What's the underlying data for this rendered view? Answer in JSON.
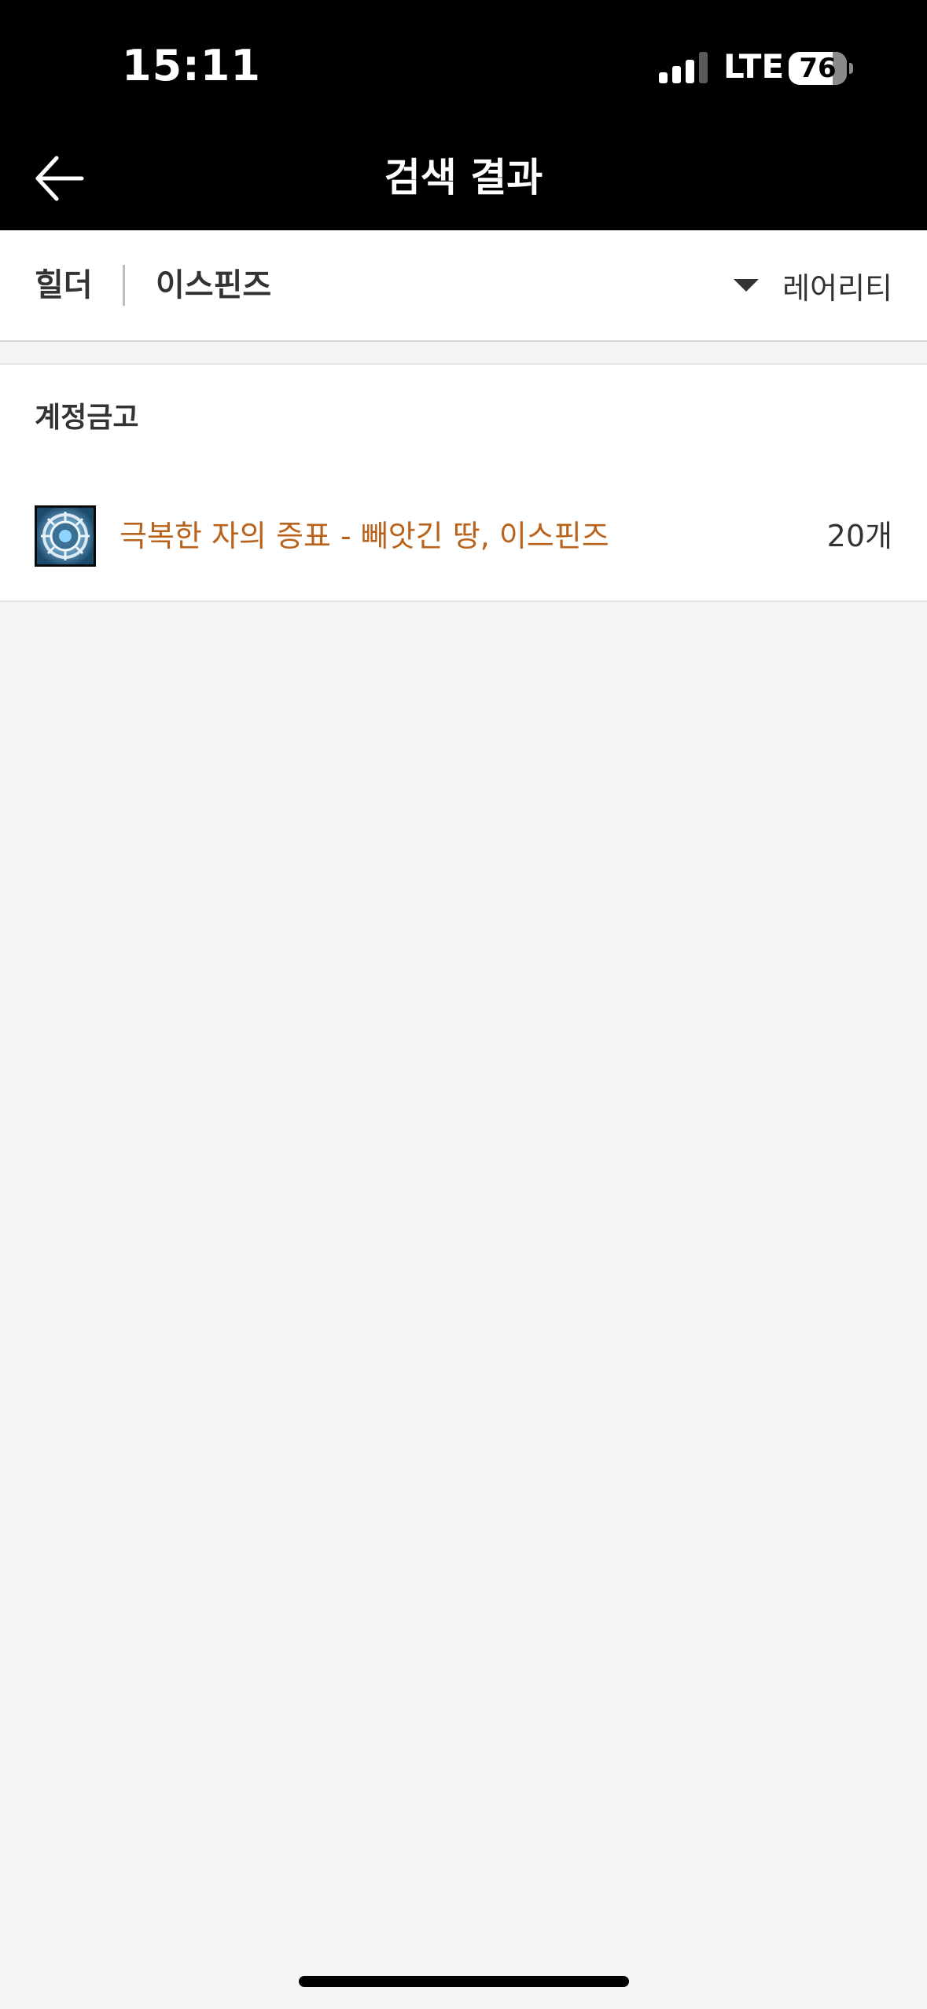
{
  "status_bar": {
    "time": "15:11",
    "network": "LTE",
    "battery": "76"
  },
  "nav": {
    "title": "검색 결과",
    "back_icon": "arrow-left-icon"
  },
  "filter": {
    "server": "힐더",
    "character": "이스핀즈",
    "sort_label": "레어리티",
    "sort_icon": "caret-down-icon"
  },
  "results": {
    "section_title": "계정금고",
    "items": [
      {
        "name": "극복한 자의 증표 - 빼앗긴 땅, 이스핀즈",
        "count": "20개",
        "icon": "emblem-icon",
        "name_color": "#b8621b"
      }
    ]
  },
  "colors": {
    "header_bg": "#000000",
    "page_bg": "#f4f4f4",
    "item_accent": "#b8621b"
  }
}
